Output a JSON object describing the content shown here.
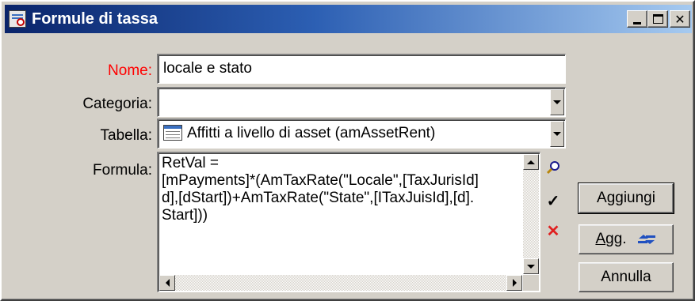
{
  "window": {
    "title": "Formule di tassa",
    "controls": {
      "minimize": "_",
      "maximize": "□",
      "close": "✕"
    }
  },
  "form": {
    "name": {
      "label": "Nome:",
      "value": "locale e stato",
      "label_color": "#ff0000"
    },
    "category": {
      "label": "Categoria:",
      "value": ""
    },
    "table": {
      "label": "Tabella:",
      "value": "Affitti a livello di asset (amAssetRent)",
      "icon": "table-icon"
    },
    "formula": {
      "label": "Formula:",
      "value": "RetVal =\n[mPayments]*(AmTaxRate(\"Locale\",[TaxJurisId]\nd],[dStart])+AmTaxRate(\"State\",[ITaxJuisId],[d].\nStart]))"
    }
  },
  "formula_tools": {
    "zoom": {
      "icon": "magnifier-icon",
      "glyph": "🔍"
    },
    "validate": {
      "icon": "checkmark-icon",
      "glyph": "✓"
    },
    "clear": {
      "icon": "delete-x-icon",
      "glyph": "✕"
    }
  },
  "buttons": {
    "add": "Aggiungi",
    "modify_prefix": "A",
    "modify_rest": "gg.",
    "cancel": "Annulla"
  },
  "colors": {
    "titlebar_start": "#0a246a",
    "titlebar_end": "#a6caf0",
    "required_label": "#ff0000",
    "window_bg": "#d4d0c8"
  }
}
